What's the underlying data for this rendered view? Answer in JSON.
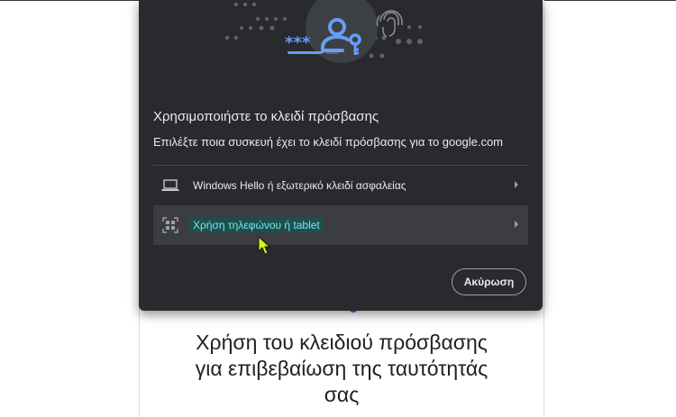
{
  "dialog": {
    "title": "Χρησιμοποιήστε το κλειδί πρόσβασης",
    "description": "Επιλέξτε ποια συσκευή έχει το κλειδί πρόσβασης για το google.com",
    "options": [
      {
        "label": "Windows Hello ή εξωτερικό κλειδί ασφαλείας",
        "icon": "laptop-icon"
      },
      {
        "label": "Χρήση τηλεφώνου ή tablet",
        "icon": "qr-code-icon",
        "selected": true
      }
    ],
    "cancel_label": "Ακύρωση"
  },
  "page": {
    "heading_lines": [
      "Χρήση του κλειδιού πρόσβασης",
      "για επιβεβαίωση της ταυτότητάς",
      "σας"
    ]
  },
  "colors": {
    "dialog_bg": "#292a2d",
    "accent_blue": "#669df6",
    "selected_row": "#3c3d41",
    "highlight_text": "#76e8e8"
  }
}
